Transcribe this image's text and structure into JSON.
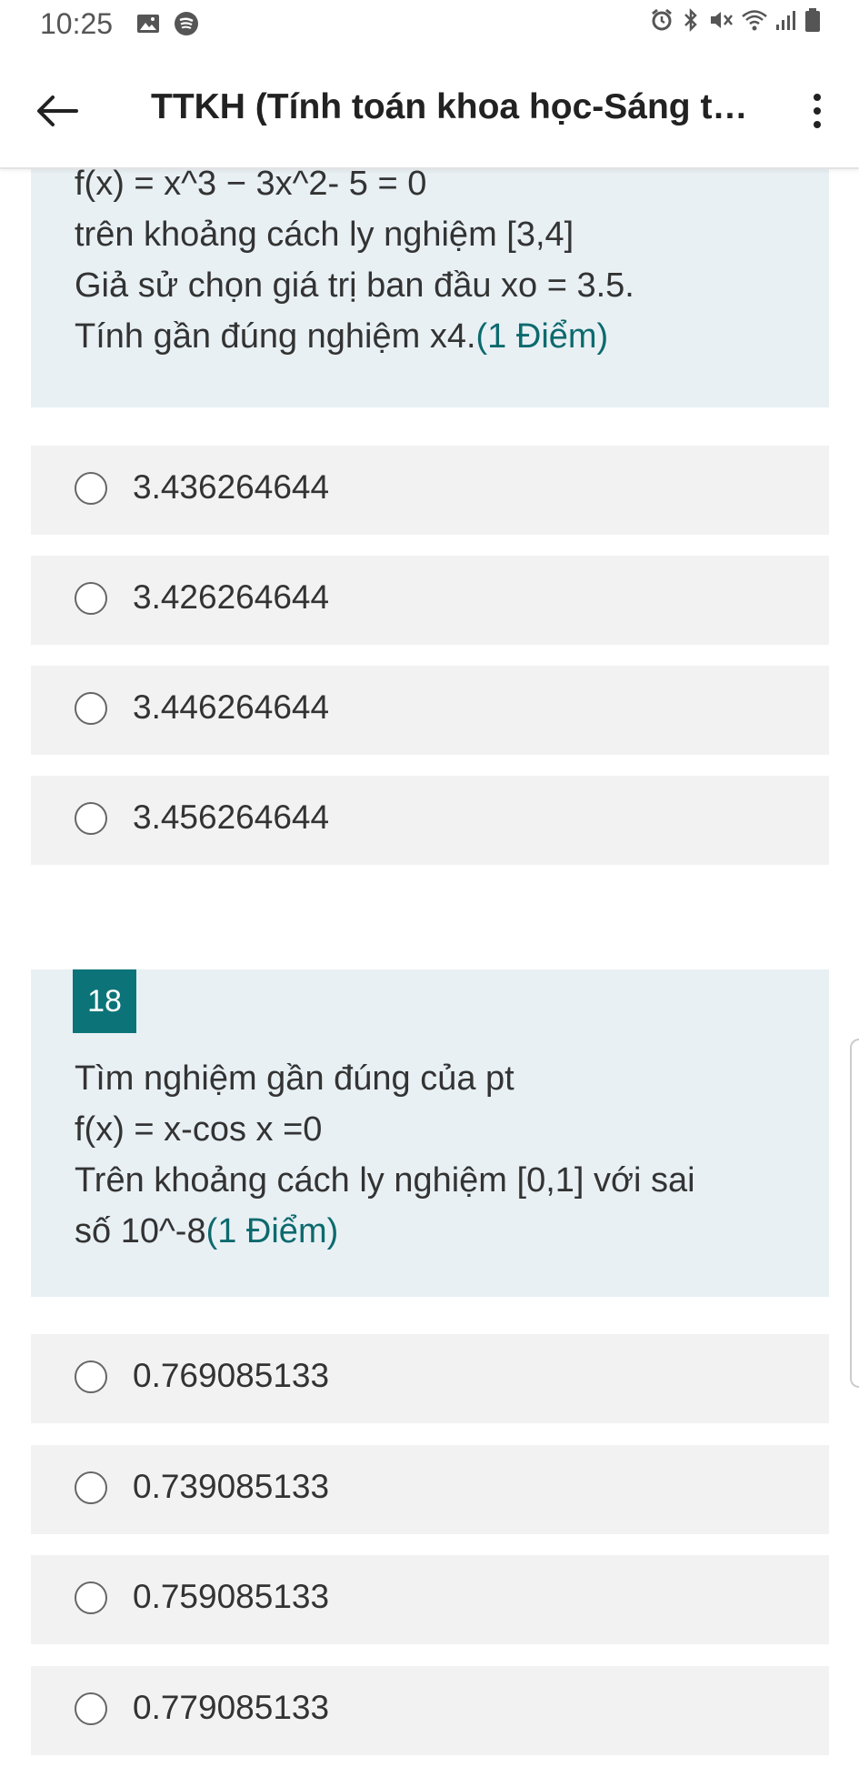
{
  "status": {
    "time": "10:25",
    "left_icons": [
      "gallery-icon",
      "spotify-icon"
    ],
    "right_icons": [
      "alarm-icon",
      "bluetooth-icon",
      "mute-icon",
      "wifi-icon",
      "signal-icon",
      "battery-icon"
    ]
  },
  "appbar": {
    "title": "TTKH (Tính toán khoa học-Sáng th..."
  },
  "question17": {
    "lines": [
      "f(x) = x^3 − 3x^2- 5 = 0",
      "trên khoảng cách ly nghiệm [3,4]",
      "Giả sử chọn giá trị ban đầu xo = 3.5.",
      "Tính gần đúng nghiệm x4."
    ],
    "points": "(1 Điểm)",
    "options": [
      "3.436264644",
      "3.426264644",
      "3.446264644",
      "3.456264644"
    ]
  },
  "question18": {
    "number": "18",
    "lines": [
      "Tìm nghiệm gần đúng của pt",
      "f(x) = x-cos x =0",
      "Trên khoảng cách ly nghiệm [0,1] với sai",
      "số 10^-8"
    ],
    "points": "(1 Điểm)",
    "options": [
      "0.769085133",
      "0.739085133",
      "0.759085133",
      "0.779085133"
    ]
  },
  "colors": {
    "accent": "#0c7478",
    "question_bg": "#e8f0f4",
    "option_bg": "#f2f2f2"
  }
}
